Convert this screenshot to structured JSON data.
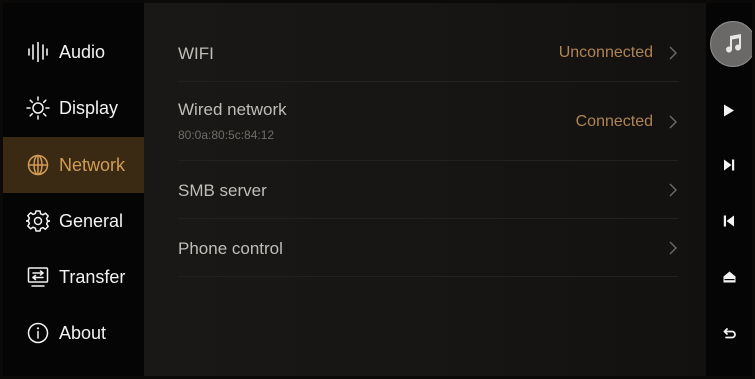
{
  "sidebar": {
    "items": [
      {
        "label": "Audio",
        "icon": "audio-waveform-icon"
      },
      {
        "label": "Display",
        "icon": "brightness-sun-icon"
      },
      {
        "label": "Network",
        "icon": "globe-icon",
        "active": true
      },
      {
        "label": "General",
        "icon": "gear-icon"
      },
      {
        "label": "Transfer",
        "icon": "transfer-monitor-icon"
      },
      {
        "label": "About",
        "icon": "info-icon"
      }
    ]
  },
  "network": {
    "rows": [
      {
        "label": "WIFI",
        "status": "Unconnected"
      },
      {
        "label": "Wired network",
        "sub": "80:0a:80:5c:84:12",
        "status": "Connected"
      },
      {
        "label": "SMB server"
      },
      {
        "label": "Phone control"
      }
    ]
  },
  "controls": {
    "icons": [
      "music-note-icon",
      "play-icon",
      "next-track-icon",
      "previous-track-icon",
      "home-icon",
      "back-icon"
    ]
  },
  "colors": {
    "accent": "#d39b55",
    "status": "#b08352",
    "active_bg": "#3a2a14"
  }
}
